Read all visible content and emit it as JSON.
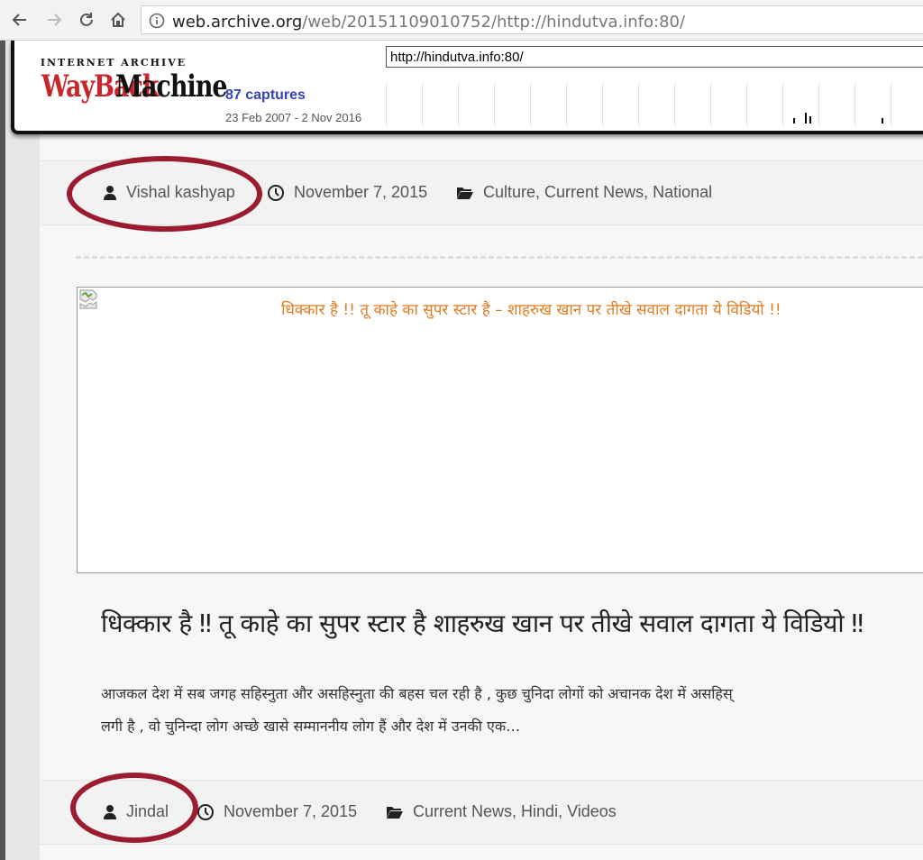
{
  "browser": {
    "url_host": "web.archive.org",
    "url_path": "/web/20151109010752/http://hindutva.info:80/"
  },
  "wayback": {
    "logo_top": "INTERNET ARCHIVE",
    "logo_wayback": "WayBack",
    "logo_machine": "Machine",
    "url_input_value": "http://hindutva.info:80/",
    "captures": "87 captures",
    "date_range": "23 Feb 2007 - 2 Nov 2016"
  },
  "posts": [
    {
      "author": "Vishal kashyap",
      "date": "November 7, 2015",
      "categories": [
        "Culture",
        "Current News",
        "National"
      ]
    },
    {
      "image_alt": "धिक्कार है !! तू काहे का सुपर स्टार है – शाहरुख खान पर तीखे सवाल दागता ये विडियो !!",
      "title": "धिक्कार है ‼ तू काहे का सुपर स्टार है शाहरुख खान पर तीखे सवाल दागता ये विडियो ‼",
      "excerpt_line1": "आजकल देश में सब जगह सहिस्नुता और असहिस्नुता की बहस चल रही है , कुछ चुनिदा लोगों को अचानक देश में असहिस्",
      "excerpt_line2": "लगी है , वो चुनिन्दा लोग अच्छे खासे सम्माननीय लोग हैं और देश में उनकी एक…",
      "author": "Jindal",
      "date": "November 7, 2015",
      "categories": [
        "Current News",
        "Hindi",
        "Videos"
      ]
    }
  ],
  "separators": {
    "comma": ", "
  },
  "colors": {
    "annotation_circle": "#9b1c30",
    "captures_link": "#3344bb",
    "image_alt_text": "#e07b20",
    "wayback_red": "#c9262c"
  },
  "icons": [
    "back-icon",
    "forward-icon",
    "reload-icon",
    "home-icon",
    "info-icon",
    "user-icon",
    "clock-icon",
    "folder-open-icon",
    "broken-image-icon"
  ]
}
